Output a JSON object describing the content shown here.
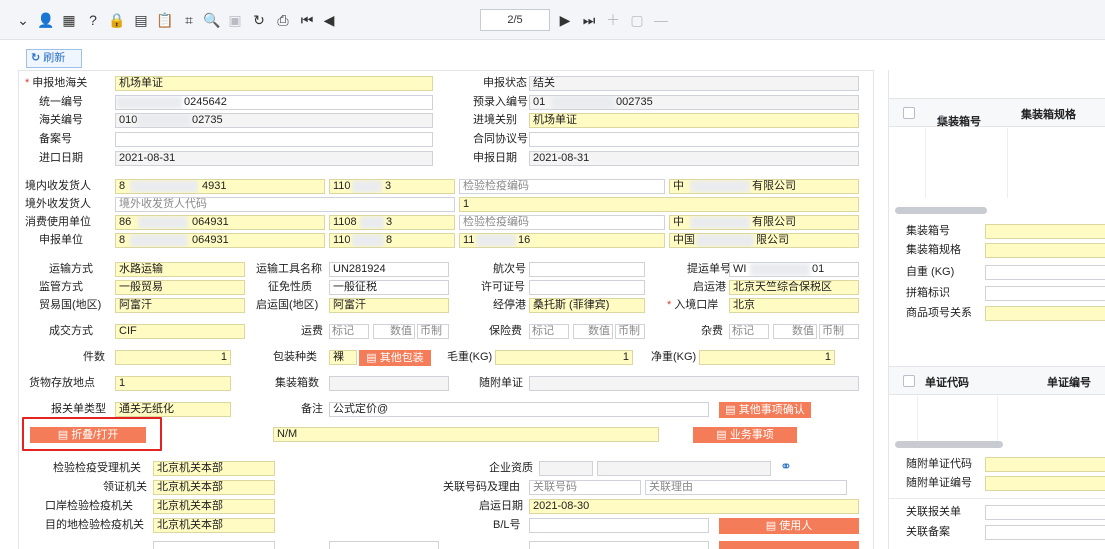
{
  "toolbar": {
    "page_indicator": "2/5"
  },
  "actions": {
    "refresh_label": "刷新"
  },
  "form": {
    "row1": {
      "declare_customs_label": "申报地海关",
      "declare_customs_value": "机场单证",
      "declare_status_label": "申报状态",
      "declare_status_value": "结关"
    },
    "row2": {
      "unified_no_label": "统一编号",
      "unified_no_value": "0245642",
      "pre_entry_label": "预录入编号",
      "pre_entry_prefix": "01",
      "pre_entry_suffix": "002735"
    },
    "row3": {
      "customs_no_label": "海关编号",
      "customs_no_prefix": "010",
      "customs_no_suffix": "02735",
      "entry_type_label": "进境关别",
      "entry_type_value": "机场单证"
    },
    "row4": {
      "record_no_label": "备案号",
      "contract_label": "合同协议号"
    },
    "row5": {
      "import_date_label": "进口日期",
      "import_date_value": "2021-08-31",
      "declare_date_label": "申报日期",
      "declare_date_value": "2021-08-31"
    },
    "party": {
      "domestic_consignee_label": "境内收发货人",
      "domestic_code_a_pre": "8",
      "domestic_code_a_suf": "4931",
      "domestic_code_b_pre": "110",
      "domestic_code_b_suf": "3",
      "domestic_ciq_placeholder": "检验检疫编码",
      "domestic_name_pre": "中",
      "domestic_name_suf": "有限公司",
      "foreign_consignee_label": "境外收发货人",
      "foreign_code_placeholder": "境外收发货人代码",
      "foreign_name": "1",
      "consumer_label": "消费使用单位",
      "consumer_code_a_pre": "86",
      "consumer_code_a_suf": "064931",
      "consumer_code_b_pre": "1108",
      "consumer_code_b_suf": "3",
      "consumer_ciq_placeholder": "检验检疫编码",
      "consumer_name_pre": "中",
      "consumer_name_suf": "有限公司",
      "declarant_label": "申报单位",
      "declarant_code_a_pre": "8",
      "declarant_code_a_suf": "064931",
      "declarant_code_b_pre": "110",
      "declarant_code_b_suf": "8",
      "declarant_ciq_pre": "11",
      "declarant_ciq_suf": "16",
      "declarant_name_pre": "中国",
      "declarant_name_suf": "限公司"
    },
    "transport": {
      "transport_mode_label": "运输方式",
      "transport_mode_value": "水路运输",
      "vehicle_name_label": "运输工具名称",
      "vehicle_name_value": "UN281924",
      "voyage_label": "航次号",
      "bl_label": "提运单号",
      "bl_prefix": "WI",
      "bl_suffix": "01",
      "supervision_label": "监管方式",
      "supervision_value": "一般贸易",
      "exemption_label": "征免性质",
      "exemption_value": "一般征税",
      "license_label": "许可证号",
      "departure_port_label": "启运港",
      "departure_port_value": "北京天竺综合保税区",
      "trade_country_label": "贸易国(地区)",
      "trade_country_value": "阿富汗",
      "origin_country_label": "启运国(地区)",
      "origin_country_value": "阿富汗",
      "stop_port_label": "经停港",
      "stop_port_value": "桑托斯 (菲律宾)",
      "entry_port_label": "入境口岸",
      "entry_port_value": "北京"
    },
    "fees": {
      "deal_mode_label": "成交方式",
      "deal_mode_value": "CIF",
      "freight_label": "运费",
      "insurance_label": "保险费",
      "misc_label": "杂费",
      "mark_placeholder": "标记",
      "value_placeholder": "数值",
      "currency_placeholder": "币制"
    },
    "packing": {
      "pieces_label": "件数",
      "pieces_value": "1",
      "package_type_label": "包装种类",
      "package_type_value": "裸",
      "other_package_button": "其他包装",
      "gross_weight_label": "毛重(KG)",
      "gross_weight_value": "1",
      "net_weight_label": "净重(KG)",
      "net_weight_value": "1"
    },
    "storage": {
      "storage_place_label": "货物存放地点",
      "storage_place_value": "1",
      "container_count_label": "集装箱数",
      "attached_docs_label": "随附单证"
    },
    "decl_type": {
      "decl_type_label": "报关单类型",
      "decl_type_value": "通关无纸化",
      "remark_label": "备注",
      "remark_value": "公式定价@",
      "other_confirm_button": "其他事项确认"
    },
    "collapse": {
      "collapse_button": "折叠/打开",
      "nm_value": "N/M",
      "business_button": "业务事项"
    },
    "inspection": {
      "ciq_office_label": "检验检疫受理机关",
      "ciq_office_value": "北京机关本部",
      "qualification_label": "企业资质",
      "cert_office_label": "领证机关",
      "cert_office_value": "北京机关本部",
      "related_no_label": "关联号码及理由",
      "related_no_placeholder": "关联号码",
      "related_reason_placeholder": "关联理由",
      "port_ciq_label": "口岸检验检疫机关",
      "port_ciq_value": "北京机关本部",
      "departure_date_label": "启运日期",
      "departure_date_value": "2021-08-30",
      "dest_ciq_label": "目的地检验检疫机关",
      "dest_ciq_value": "北京机关本部",
      "bl_no_label": "B/L号",
      "user_button": "使用人"
    }
  },
  "right_panel": {
    "container_grid": {
      "col_container_no": "集装箱号",
      "col_container_spec": "集装箱规格"
    },
    "container_detail": {
      "container_no_label": "集装箱号",
      "container_spec_label": "集装箱规格",
      "self_weight_label": "自重 (KG)",
      "lcl_label": "拼箱标识",
      "item_relation_label": "商品项号关系"
    },
    "doc_grid": {
      "col_doc_code": "单证代码",
      "col_doc_no": "单证编号"
    },
    "doc_detail": {
      "doc_code_label": "随附单证代码",
      "doc_no_label": "随附单证编号"
    },
    "related": {
      "related_decl_label": "关联报关单",
      "related_record_label": "关联备案"
    }
  }
}
